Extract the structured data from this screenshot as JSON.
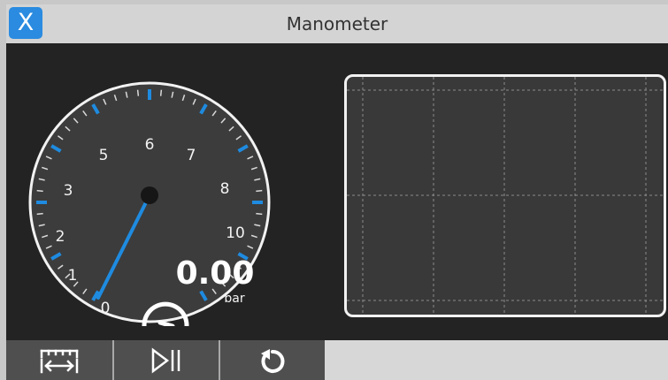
{
  "window": {
    "title": "Manometer",
    "close_label": "X"
  },
  "gauge": {
    "tick_labels": [
      "0",
      "1",
      "2",
      "3",
      "5",
      "6",
      "7",
      "8",
      "10"
    ],
    "value": "0.00",
    "unit": "bar",
    "needle_value": 0,
    "accent_color": "#1e8be0"
  },
  "toolbar": {
    "buttons": [
      {
        "icon": "range-ruler-icon"
      },
      {
        "icon": "play-pause-icon"
      },
      {
        "icon": "reset-icon"
      }
    ]
  }
}
